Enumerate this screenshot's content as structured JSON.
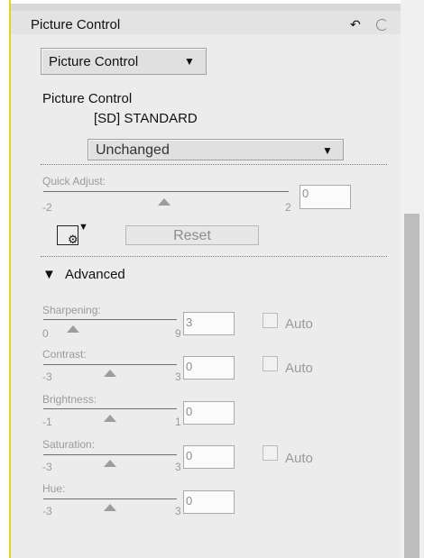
{
  "panel": {
    "title": "Picture Control",
    "header_icons": [
      "undo-icon",
      "loading-spinner-icon"
    ]
  },
  "picture_control_dropdown": {
    "value": "Picture Control",
    "arrow": "▼"
  },
  "picture_control_section": {
    "label": "Picture Control",
    "current": "[SD] STANDARD",
    "preset_select": {
      "value": "Unchanged",
      "arrow": "▼"
    }
  },
  "quick_adjust": {
    "label": "Quick Adjust:",
    "min": "-2",
    "max": "2",
    "value": "0"
  },
  "tools": {
    "wb_icon": "display-settings-icon",
    "reset_label": "Reset"
  },
  "advanced": {
    "toggle_icon": "▼",
    "label": "Advanced"
  },
  "controls": {
    "sharpening": {
      "label": "Sharpening:",
      "min": "0",
      "max": "9",
      "value": "3",
      "auto_label": "Auto"
    },
    "contrast": {
      "label": "Contrast:",
      "min": "-3",
      "max": "3",
      "value": "0",
      "auto_label": "Auto"
    },
    "brightness": {
      "label": "Brightness:",
      "min": "-1",
      "max": "1",
      "value": "0"
    },
    "saturation": {
      "label": "Saturation:",
      "min": "-3",
      "max": "3",
      "value": "0",
      "auto_label": "Auto"
    },
    "hue": {
      "label": "Hue:",
      "min": "-3",
      "max": "3",
      "value": "0"
    }
  },
  "colors": {
    "accent": "#e8d11d",
    "panel_bg": "#ececec",
    "text": "#111111",
    "disabled_text": "#9a9a9a"
  }
}
